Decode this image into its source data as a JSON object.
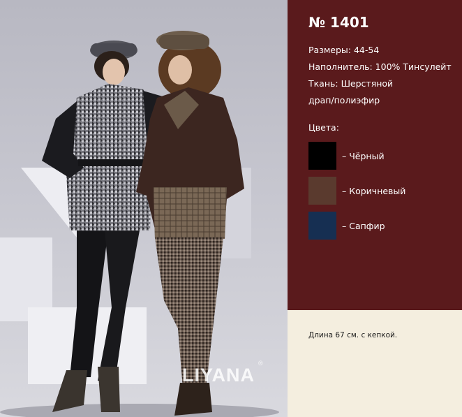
{
  "model": {
    "title": "№ 1401"
  },
  "specs": {
    "sizes": "Размеры: 44-54",
    "filler": "Наполнитель: 100% Тинсулейт",
    "fabric_line1": "Ткань: Шерстяной",
    "fabric_line2": "драп/полиэфир"
  },
  "colors_label": "Цвета:",
  "colors": [
    {
      "label": "– Чёрный",
      "hex": "#000000"
    },
    {
      "label": "– Коричневый",
      "hex": "#5a3a2e"
    },
    {
      "label": "– Сапфир",
      "hex": "#162f52"
    }
  ],
  "note": "Длина 67 см. с кепкой.",
  "brand": {
    "logo": "LIYANA",
    "reg_mark": "®"
  },
  "palette": {
    "panel": "#5a1a1c",
    "background": "#f4eedf"
  }
}
